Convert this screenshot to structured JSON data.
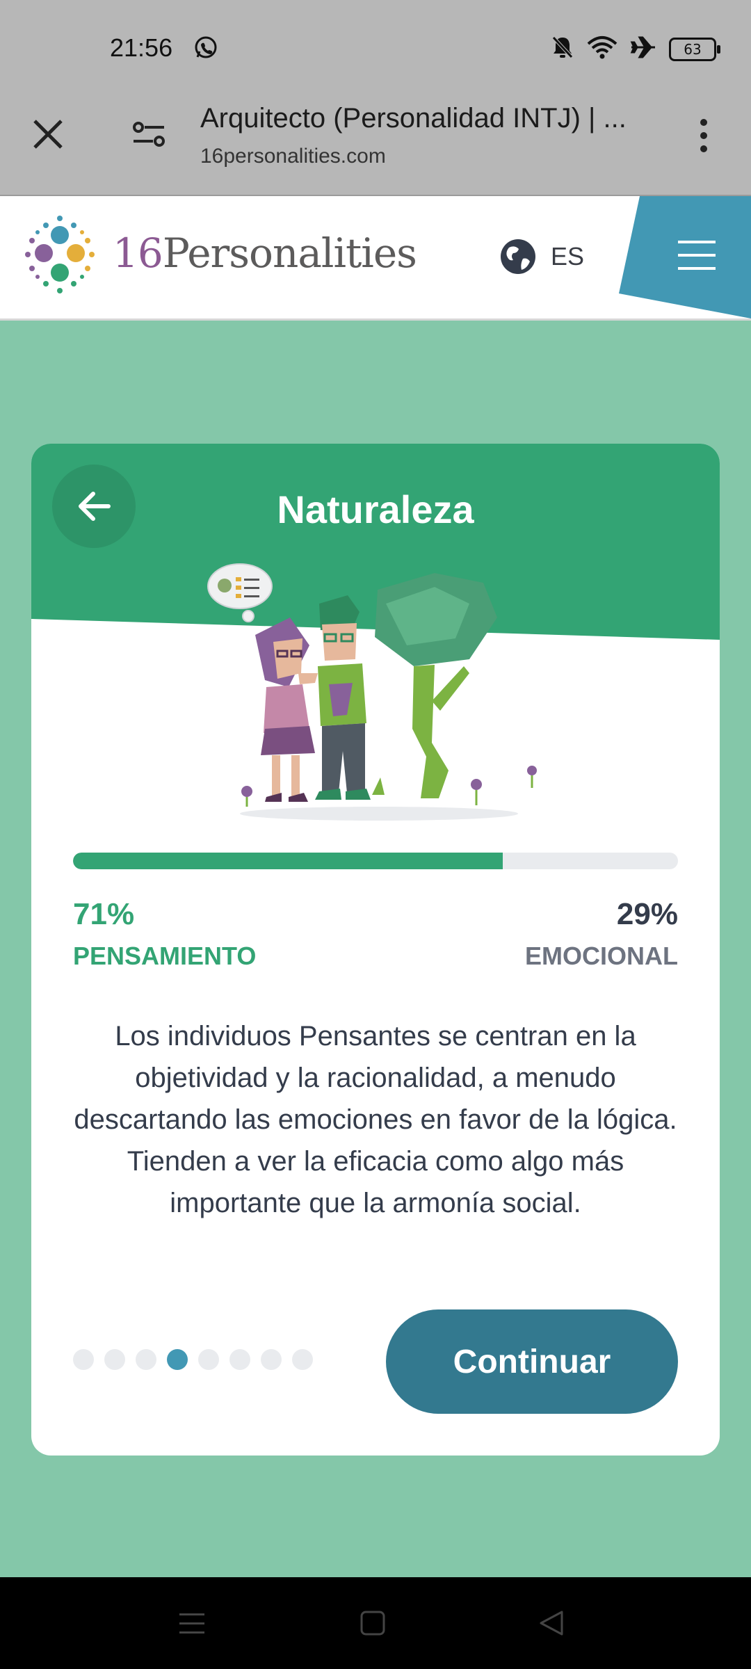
{
  "status_bar": {
    "time": "21:56",
    "battery": "63",
    "icons": [
      "whatsapp-icon",
      "bell-off-icon",
      "wifi-icon",
      "airplane-icon",
      "battery-icon"
    ]
  },
  "browser": {
    "page_title": "Arquitecto (Personalidad INTJ) | ...",
    "url": "16personalities.com"
  },
  "site_header": {
    "logo_number": "16",
    "logo_word": "Personalities",
    "language": "ES"
  },
  "card": {
    "title": "Naturaleza",
    "progress": {
      "left_percent": "71%",
      "left_label": "PENSAMIENTO",
      "right_percent": "29%",
      "right_label": "EMOCIONAL",
      "fill_fraction": 0.71
    },
    "description": "Los individuos Pensantes se centran en la objetividad y la racionalidad, a menudo descartando las emociones en favor de la lógica. Tienden a ver la eficacia como algo más importante que la armonía social.",
    "pagination": {
      "total": 8,
      "active_index": 3
    },
    "continue_label": "Continuar"
  },
  "colors": {
    "accent_green": "#33a474",
    "header_green": "#33a474",
    "background_green": "#84c7a9",
    "continue_button": "#33798f",
    "active_dot": "#4298b4",
    "menu_blue": "#4298b4"
  }
}
